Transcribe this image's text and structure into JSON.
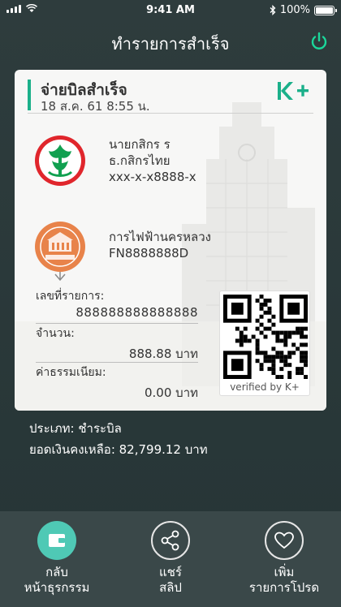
{
  "status_bar": {
    "time": "9:41 AM",
    "battery": "100%"
  },
  "header": {
    "title": "ทำรายการสำเร็จ",
    "icon": "power-icon"
  },
  "slip": {
    "title": "จ่ายบิลสำเร็จ",
    "datetime": "18 ส.ค. 61  8:55 น.",
    "brand": "K+",
    "sender": {
      "name": "นายกสิกร ร",
      "bank": "ธ.กสิกรไทย",
      "account": "xxx-x-x8888-x"
    },
    "receiver": {
      "name": "การไฟฟ้านครหลวง",
      "code": "FN8888888D"
    },
    "fields": {
      "ref_label": "เลขที่รายการ:",
      "ref_value": "888888888888888",
      "amount_label": "จำนวน:",
      "amount_value": "888.88 บาท",
      "fee_label": "ค่าธรรมเนียม:",
      "fee_value": "0.00 บาท"
    },
    "qr_caption": "verified by K+"
  },
  "summary": {
    "type": "ประเภท: ชำระบิล",
    "balance": "ยอดเงินคงเหลือ: 82,799.12 บาท"
  },
  "bottom_bar": [
    {
      "line1": "กลับ",
      "line2": "หน้าธุรกรรม",
      "icon": "wallet-icon"
    },
    {
      "line1": "แชร์",
      "line2": "สลิป",
      "icon": "share-icon"
    },
    {
      "line1": "เพิ่ม",
      "line2": "รายการโปรด",
      "icon": "heart-icon"
    }
  ],
  "colors": {
    "accent": "#4fc9b5",
    "brand_green": "#1bb08a",
    "background": "#2b3a3b"
  }
}
